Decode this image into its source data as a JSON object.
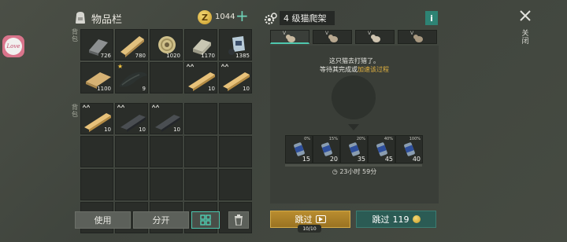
{
  "app_icon": {
    "text": "Love"
  },
  "inventory": {
    "title": "物品栏",
    "coins": "1044",
    "plus": "+",
    "storage_tab": [
      "背",
      "包"
    ],
    "backpack_tab": [
      "背",
      "包"
    ],
    "storage_slots": [
      {
        "item": "iron-bar",
        "count": "726"
      },
      {
        "item": "wood-plank",
        "count": "780"
      },
      {
        "item": "rope-spool",
        "count": "1020"
      },
      {
        "item": "stone-block",
        "count": "1170"
      },
      {
        "item": "cloth-bag",
        "count": "1385"
      },
      {
        "item": "wood-board",
        "count": "1100"
      },
      {
        "item": "crocodile",
        "count": "9",
        "star": true
      },
      {
        "item": "empty",
        "count": ""
      },
      {
        "item": "wood-beam",
        "count": "10",
        "tier": true
      },
      {
        "item": "wood-beam",
        "count": "10",
        "tier": true
      }
    ],
    "backpack_slots": [
      {
        "item": "wood-beam",
        "count": "10",
        "tier": true
      },
      {
        "item": "steel-bar",
        "count": "10",
        "tier": true
      },
      {
        "item": "steel-bar",
        "count": "10",
        "tier": true
      }
    ],
    "buttons": {
      "use": "使用",
      "split": "分开"
    }
  },
  "crafting": {
    "title": "4 级猫爬架",
    "info": "i",
    "tabs": [
      "V",
      "V",
      "V",
      "V"
    ],
    "message_line1": "这只猫去打猎了。",
    "message_line2_prefix": "等待其完成或",
    "message_line2_link": "加速该过程",
    "stages": [
      {
        "pct": "0%",
        "value": "15"
      },
      {
        "pct": "15%",
        "value": "20"
      },
      {
        "pct": "20%",
        "value": "35"
      },
      {
        "pct": "40%",
        "value": "45"
      },
      {
        "pct": "100%",
        "value": "40"
      }
    ],
    "timer": "23小时 59分",
    "skip_ad_label": "跳过",
    "skip_ad_counter": "10/10",
    "skip_pay_label": "跳过",
    "skip_pay_cost": "119"
  },
  "close": {
    "label": [
      "关",
      "闭"
    ]
  },
  "colors": {
    "accent": "#4ec7ae",
    "gold": "#b98d2f",
    "teal": "#2b5b54"
  }
}
